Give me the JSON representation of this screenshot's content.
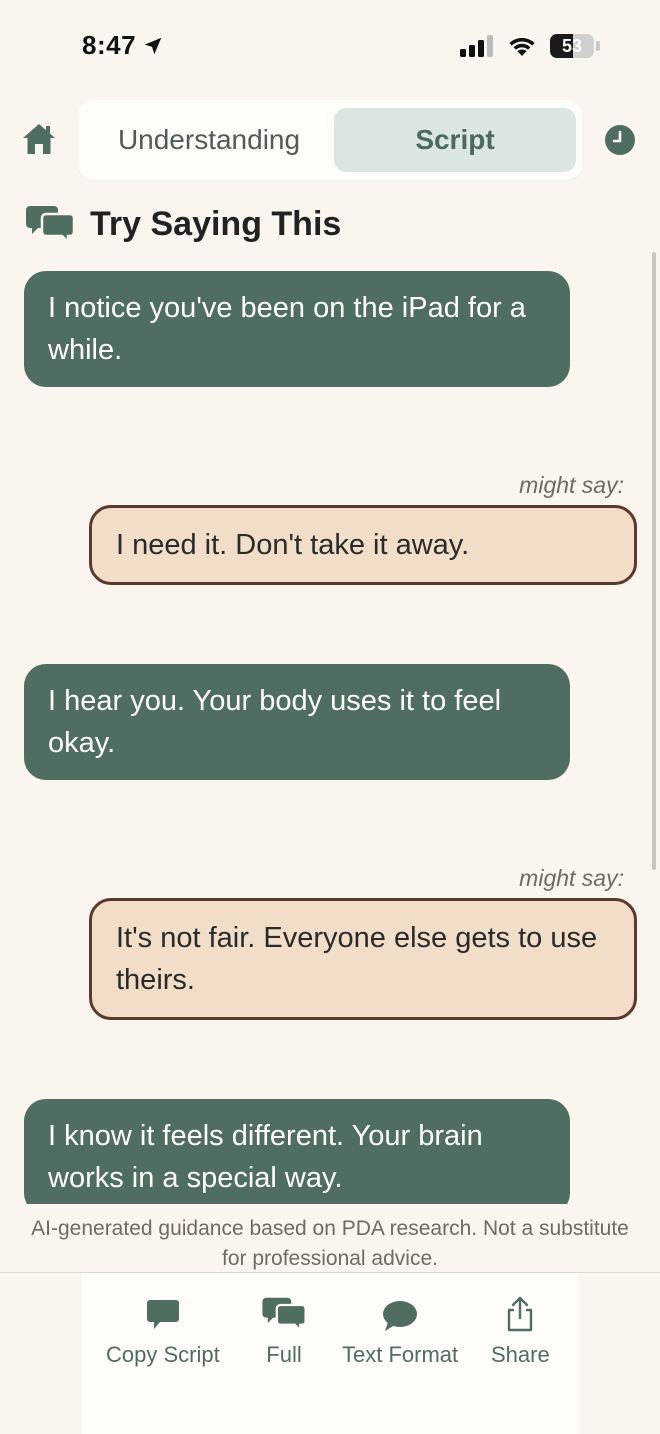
{
  "status": {
    "time": "8:47",
    "battery": "53",
    "battery_level": 0.53
  },
  "nav": {
    "tabs": [
      {
        "label": "Understanding",
        "selected": false
      },
      {
        "label": "Script",
        "selected": true
      }
    ]
  },
  "section": {
    "title": "Try Saying This"
  },
  "conversation": [
    {
      "speaker": "parent",
      "text": "I notice you've been on the iPad for a while."
    },
    {
      "speaker": "child",
      "prefix": "might say:",
      "text": "I need it. Don't take it away."
    },
    {
      "speaker": "parent",
      "text": "I hear you. Your body uses it to feel okay."
    },
    {
      "speaker": "child",
      "prefix": "might say:",
      "text": "It's not fair. Everyone else gets to use theirs."
    },
    {
      "speaker": "parent",
      "text": "I know it feels different. Your brain works in a special way."
    }
  ],
  "disclaimer": "AI-generated guidance based on PDA research. Not a substitute for professional advice.",
  "toolbar": {
    "copy_label": "Copy Script",
    "full_label": "Full",
    "text_format_label": "Text Format",
    "share_label": "Share"
  },
  "colors": {
    "accent": "#4f6e60",
    "parent_bubble": "#4f6e60",
    "child_bubble": "#f1ddc8",
    "child_border": "#5b3a2e",
    "background": "#faf6ef"
  }
}
